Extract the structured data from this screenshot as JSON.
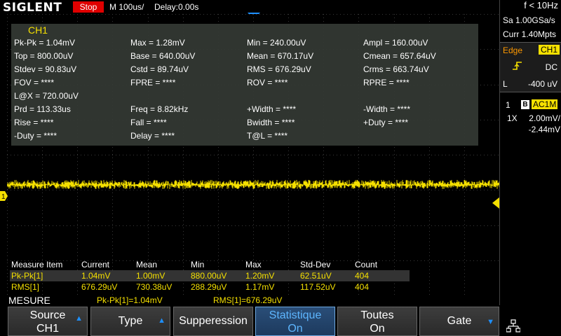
{
  "topbar": {
    "brand": "SIGLENT",
    "run_status": "Stop",
    "timebase": "M 100us/",
    "delay": "Delay:0.00s"
  },
  "right_panel": {
    "frequency": "f < 10Hz",
    "sample_rate": "Sa 1.00GSa/s",
    "memory_depth": "Curr 1.40Mpts",
    "trigger": {
      "type": "Edge",
      "source": "CH1",
      "coupling": "DC",
      "level_label": "L",
      "level_value": "-400 uV"
    },
    "channel": {
      "number": "1",
      "bw_limit": "B",
      "coupling": "AC1M",
      "probe": "1X",
      "scale": "2.00mV/",
      "offset": "-2.44mV"
    },
    "colors": {
      "trigger_source_bg": "#f5e000",
      "trigger_type": "#ff9900"
    }
  },
  "measurements": {
    "title": "CH1",
    "rows": [
      [
        "Pk-Pk = 1.04mV",
        "Max = 1.28mV",
        "Min = 240.00uV",
        "Ampl = 160.00uV"
      ],
      [
        "Top = 800.00uV",
        "Base = 640.00uV",
        "Mean = 670.17uV",
        "Cmean = 657.64uV"
      ],
      [
        "Stdev = 90.83uV",
        "Cstd = 89.74uV",
        "RMS = 676.29uV",
        "Crms = 663.74uV"
      ],
      [
        "FOV = ****",
        "FPRE = ****",
        "ROV = ****",
        "RPRE = ****"
      ],
      [
        "L@X = 720.00uV",
        "",
        "",
        ""
      ],
      [
        "Prd = 113.33us",
        "Freq = 8.82kHz",
        "+Width = ****",
        "-Width = ****"
      ],
      [
        "Rise = ****",
        "Fall = ****",
        "Bwidth = ****",
        "+Duty = ****"
      ],
      [
        "-Duty = ****",
        "Delay = ****",
        "T@L = ****",
        ""
      ]
    ]
  },
  "statistics": {
    "headers": [
      "Measure Item",
      "Current",
      "Mean",
      "Min",
      "Max",
      "Std-Dev",
      "Count"
    ],
    "rows": [
      [
        "Pk-Pk[1]",
        "1.04mV",
        "1.00mV",
        "880.00uV",
        "1.20mV",
        "62.51uV",
        "404"
      ],
      [
        "RMS[1]",
        "676.29uV",
        "730.38uV",
        "288.29uV",
        "1.17mV",
        "117.52uV",
        "404"
      ]
    ]
  },
  "menu": {
    "title": "MESURE",
    "readout_1": "Pk-Pk[1]=1.04mV",
    "readout_2": "RMS[1]=676.29uV"
  },
  "softkeys": [
    {
      "line1": "Source",
      "line2": "CH1",
      "arrow": "up"
    },
    {
      "line1": "Type",
      "line2": "",
      "arrow": "up"
    },
    {
      "line1": "Supperession",
      "line2": "",
      "arrow": ""
    },
    {
      "line1": "Statistique",
      "line2": "On",
      "arrow": "",
      "active": true
    },
    {
      "line1": "Toutes",
      "line2": "On",
      "arrow": ""
    },
    {
      "line1": "Gate",
      "line2": "",
      "arrow": "down"
    }
  ],
  "waveform": {
    "channel_marker": "1",
    "color": "#f5e000",
    "description_level": "noise trace near channel offset"
  }
}
